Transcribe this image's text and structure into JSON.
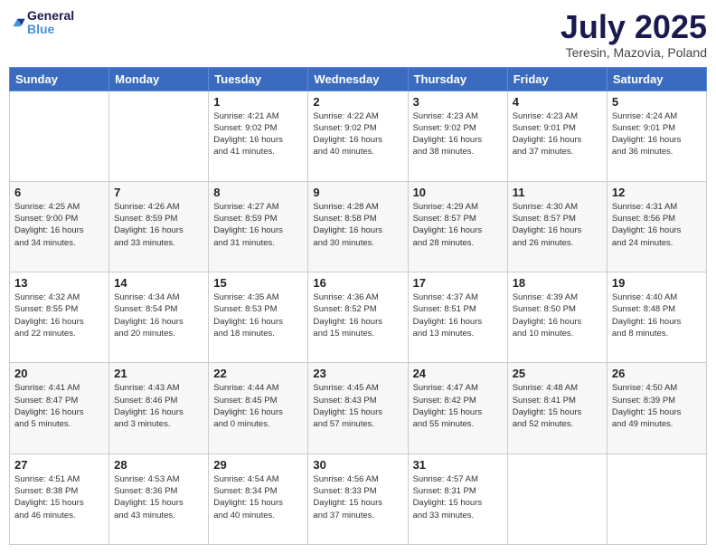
{
  "logo": {
    "text_general": "General",
    "text_blue": "Blue"
  },
  "header": {
    "month": "July 2025",
    "location": "Teresin, Mazovia, Poland"
  },
  "weekdays": [
    "Sunday",
    "Monday",
    "Tuesday",
    "Wednesday",
    "Thursday",
    "Friday",
    "Saturday"
  ],
  "weeks": [
    [
      {
        "day": "",
        "info": ""
      },
      {
        "day": "",
        "info": ""
      },
      {
        "day": "1",
        "info": "Sunrise: 4:21 AM\nSunset: 9:02 PM\nDaylight: 16 hours\nand 41 minutes."
      },
      {
        "day": "2",
        "info": "Sunrise: 4:22 AM\nSunset: 9:02 PM\nDaylight: 16 hours\nand 40 minutes."
      },
      {
        "day": "3",
        "info": "Sunrise: 4:23 AM\nSunset: 9:02 PM\nDaylight: 16 hours\nand 38 minutes."
      },
      {
        "day": "4",
        "info": "Sunrise: 4:23 AM\nSunset: 9:01 PM\nDaylight: 16 hours\nand 37 minutes."
      },
      {
        "day": "5",
        "info": "Sunrise: 4:24 AM\nSunset: 9:01 PM\nDaylight: 16 hours\nand 36 minutes."
      }
    ],
    [
      {
        "day": "6",
        "info": "Sunrise: 4:25 AM\nSunset: 9:00 PM\nDaylight: 16 hours\nand 34 minutes."
      },
      {
        "day": "7",
        "info": "Sunrise: 4:26 AM\nSunset: 8:59 PM\nDaylight: 16 hours\nand 33 minutes."
      },
      {
        "day": "8",
        "info": "Sunrise: 4:27 AM\nSunset: 8:59 PM\nDaylight: 16 hours\nand 31 minutes."
      },
      {
        "day": "9",
        "info": "Sunrise: 4:28 AM\nSunset: 8:58 PM\nDaylight: 16 hours\nand 30 minutes."
      },
      {
        "day": "10",
        "info": "Sunrise: 4:29 AM\nSunset: 8:57 PM\nDaylight: 16 hours\nand 28 minutes."
      },
      {
        "day": "11",
        "info": "Sunrise: 4:30 AM\nSunset: 8:57 PM\nDaylight: 16 hours\nand 26 minutes."
      },
      {
        "day": "12",
        "info": "Sunrise: 4:31 AM\nSunset: 8:56 PM\nDaylight: 16 hours\nand 24 minutes."
      }
    ],
    [
      {
        "day": "13",
        "info": "Sunrise: 4:32 AM\nSunset: 8:55 PM\nDaylight: 16 hours\nand 22 minutes."
      },
      {
        "day": "14",
        "info": "Sunrise: 4:34 AM\nSunset: 8:54 PM\nDaylight: 16 hours\nand 20 minutes."
      },
      {
        "day": "15",
        "info": "Sunrise: 4:35 AM\nSunset: 8:53 PM\nDaylight: 16 hours\nand 18 minutes."
      },
      {
        "day": "16",
        "info": "Sunrise: 4:36 AM\nSunset: 8:52 PM\nDaylight: 16 hours\nand 15 minutes."
      },
      {
        "day": "17",
        "info": "Sunrise: 4:37 AM\nSunset: 8:51 PM\nDaylight: 16 hours\nand 13 minutes."
      },
      {
        "day": "18",
        "info": "Sunrise: 4:39 AM\nSunset: 8:50 PM\nDaylight: 16 hours\nand 10 minutes."
      },
      {
        "day": "19",
        "info": "Sunrise: 4:40 AM\nSunset: 8:48 PM\nDaylight: 16 hours\nand 8 minutes."
      }
    ],
    [
      {
        "day": "20",
        "info": "Sunrise: 4:41 AM\nSunset: 8:47 PM\nDaylight: 16 hours\nand 5 minutes."
      },
      {
        "day": "21",
        "info": "Sunrise: 4:43 AM\nSunset: 8:46 PM\nDaylight: 16 hours\nand 3 minutes."
      },
      {
        "day": "22",
        "info": "Sunrise: 4:44 AM\nSunset: 8:45 PM\nDaylight: 16 hours\nand 0 minutes."
      },
      {
        "day": "23",
        "info": "Sunrise: 4:45 AM\nSunset: 8:43 PM\nDaylight: 15 hours\nand 57 minutes."
      },
      {
        "day": "24",
        "info": "Sunrise: 4:47 AM\nSunset: 8:42 PM\nDaylight: 15 hours\nand 55 minutes."
      },
      {
        "day": "25",
        "info": "Sunrise: 4:48 AM\nSunset: 8:41 PM\nDaylight: 15 hours\nand 52 minutes."
      },
      {
        "day": "26",
        "info": "Sunrise: 4:50 AM\nSunset: 8:39 PM\nDaylight: 15 hours\nand 49 minutes."
      }
    ],
    [
      {
        "day": "27",
        "info": "Sunrise: 4:51 AM\nSunset: 8:38 PM\nDaylight: 15 hours\nand 46 minutes."
      },
      {
        "day": "28",
        "info": "Sunrise: 4:53 AM\nSunset: 8:36 PM\nDaylight: 15 hours\nand 43 minutes."
      },
      {
        "day": "29",
        "info": "Sunrise: 4:54 AM\nSunset: 8:34 PM\nDaylight: 15 hours\nand 40 minutes."
      },
      {
        "day": "30",
        "info": "Sunrise: 4:56 AM\nSunset: 8:33 PM\nDaylight: 15 hours\nand 37 minutes."
      },
      {
        "day": "31",
        "info": "Sunrise: 4:57 AM\nSunset: 8:31 PM\nDaylight: 15 hours\nand 33 minutes."
      },
      {
        "day": "",
        "info": ""
      },
      {
        "day": "",
        "info": ""
      }
    ]
  ]
}
